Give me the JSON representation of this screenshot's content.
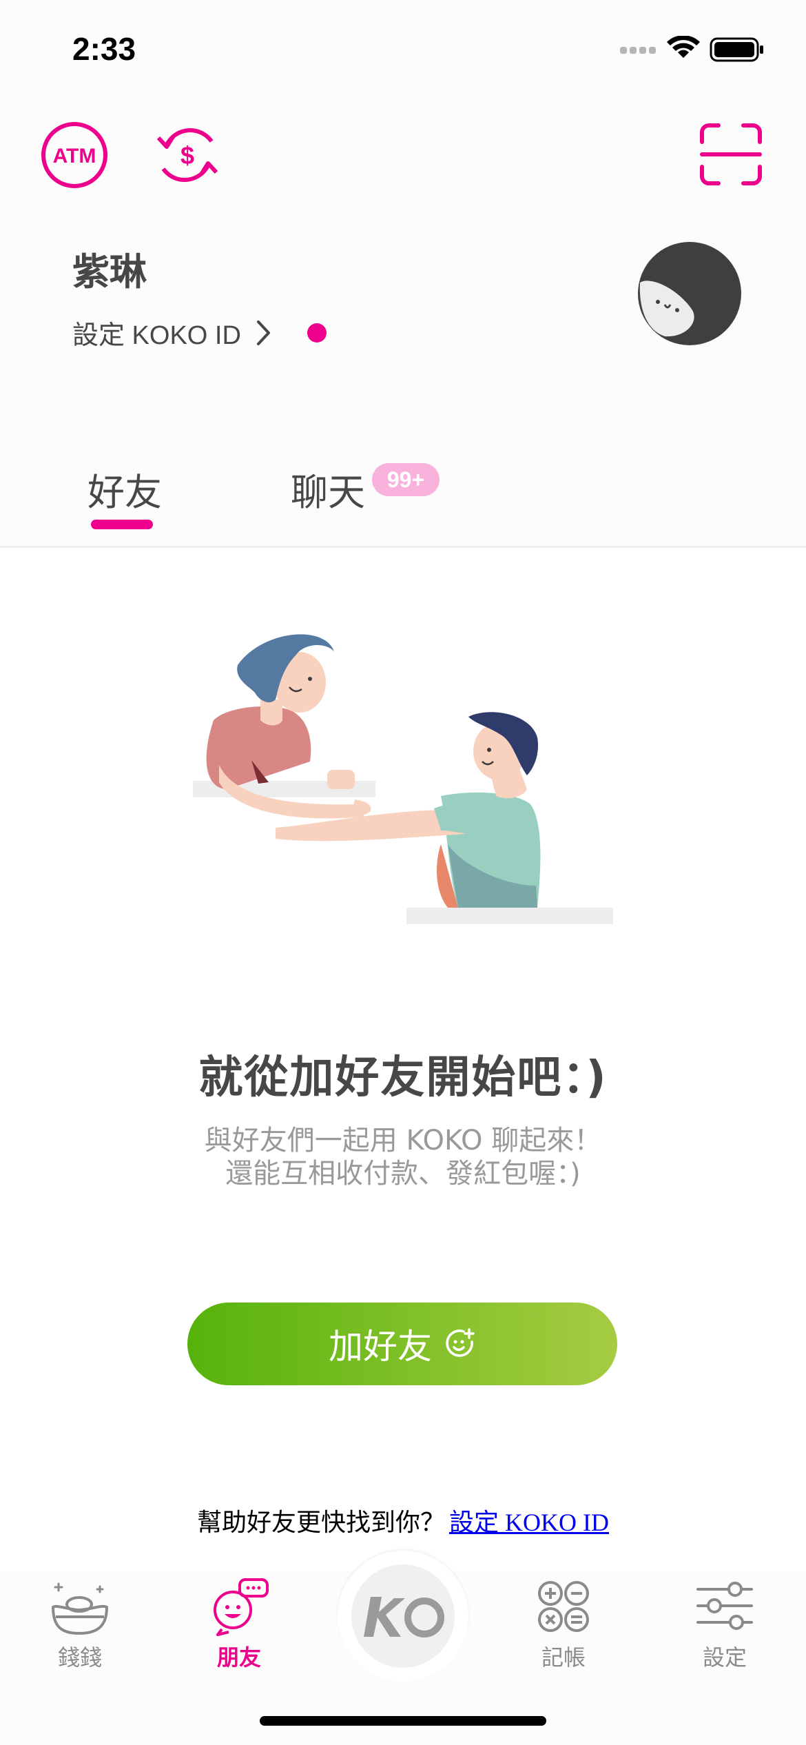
{
  "status_bar": {
    "time": "2:33"
  },
  "header": {
    "atm_icon_label": "ATM",
    "user_name": "紫琳",
    "koko_id_label": "設定 KOKO ID",
    "notification_dot": true
  },
  "tabs": {
    "friends_label": "好友",
    "chat_label": "聊天",
    "chat_badge": "99+"
  },
  "empty_state": {
    "title": "就從加好友開始吧：)",
    "subtitle_line1": "與好友們一起用 KOKO 聊起來！",
    "subtitle_line2": "還能互相收付款、發紅包喔：)"
  },
  "add_friend_button": {
    "label": "加好友"
  },
  "help": {
    "text": "幫助好友更快找到你？",
    "link": "設定 KOKO ID"
  },
  "bottom_nav": {
    "items": [
      {
        "label": "錢錢",
        "icon": "money-icon",
        "active": false
      },
      {
        "label": "朋友",
        "icon": "friends-icon",
        "active": true
      },
      {
        "label": "",
        "icon": "ko-logo-icon",
        "active": false
      },
      {
        "label": "記帳",
        "icon": "calculator-icon",
        "active": false
      },
      {
        "label": "設定",
        "icon": "sliders-icon",
        "active": false
      }
    ]
  },
  "colors": {
    "accent": "#ec008c",
    "button_green_start": "#56b30b",
    "button_green_end": "#a6cc42",
    "text_dark": "#474747",
    "text_grey": "#999999"
  }
}
